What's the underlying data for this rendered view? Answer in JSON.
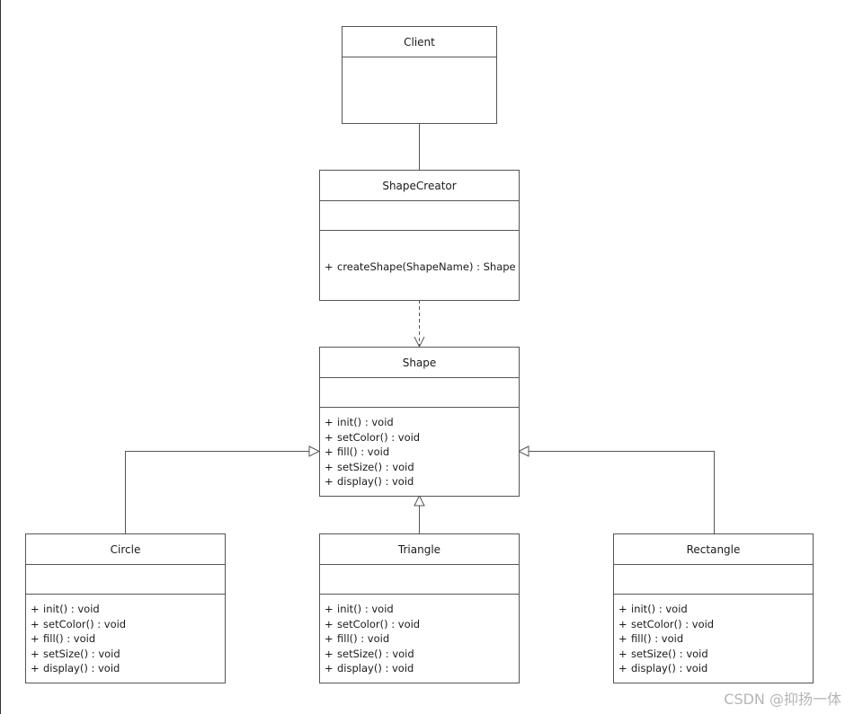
{
  "classes": {
    "client": {
      "name": "Client",
      "methods": []
    },
    "shape_creator": {
      "name": "ShapeCreator",
      "methods": [
        {
          "vis": "+",
          "sig": "createShape(ShapeName) : Shape"
        }
      ]
    },
    "shape": {
      "name": "Shape",
      "methods": [
        {
          "vis": "+",
          "sig": "init() : void"
        },
        {
          "vis": "+",
          "sig": "setColor() : void"
        },
        {
          "vis": "+",
          "sig": "fill() : void"
        },
        {
          "vis": "+",
          "sig": "setSize() : void"
        },
        {
          "vis": "+",
          "sig": "display() : void"
        }
      ]
    },
    "circle": {
      "name": "Circle",
      "methods": [
        {
          "vis": "+",
          "sig": "init() : void"
        },
        {
          "vis": "+",
          "sig": "setColor() : void"
        },
        {
          "vis": "+",
          "sig": "fill() : void"
        },
        {
          "vis": "+",
          "sig": "setSize() : void"
        },
        {
          "vis": "+",
          "sig": "display() : void"
        }
      ]
    },
    "triangle": {
      "name": "Triangle",
      "methods": [
        {
          "vis": "+",
          "sig": "init() : void"
        },
        {
          "vis": "+",
          "sig": "setColor() : void"
        },
        {
          "vis": "+",
          "sig": "fill() : void"
        },
        {
          "vis": "+",
          "sig": "setSize() : void"
        },
        {
          "vis": "+",
          "sig": "display() : void"
        }
      ]
    },
    "rectangle": {
      "name": "Rectangle",
      "methods": [
        {
          "vis": "+",
          "sig": "init() : void"
        },
        {
          "vis": "+",
          "sig": "setColor() : void"
        },
        {
          "vis": "+",
          "sig": "fill() : void"
        },
        {
          "vis": "+",
          "sig": "setSize() : void"
        },
        {
          "vis": "+",
          "sig": "display() : void"
        }
      ]
    }
  },
  "relations": [
    {
      "from": "Client",
      "to": "ShapeCreator",
      "type": "association"
    },
    {
      "from": "ShapeCreator",
      "to": "Shape",
      "type": "dependency"
    },
    {
      "from": "Circle",
      "to": "Shape",
      "type": "generalization"
    },
    {
      "from": "Triangle",
      "to": "Shape",
      "type": "generalization"
    },
    {
      "from": "Rectangle",
      "to": "Shape",
      "type": "generalization"
    }
  ],
  "watermark": "CSDN @抑扬一体"
}
